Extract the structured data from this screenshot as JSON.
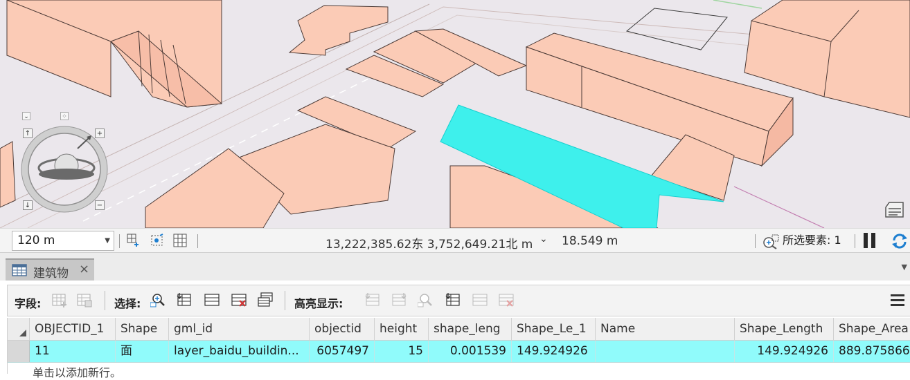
{
  "status_bar": {
    "scale": "120 m",
    "coordinates": "13,222,385.62东 3,752,649.21北 m",
    "elevation": "18.549 m",
    "selected_features": "所选要素: 1"
  },
  "tab": {
    "label": "建筑物",
    "close": "×"
  },
  "toolbar": {
    "fields_label": "字段:",
    "selection_label": "选择:",
    "highlight_label": "高亮显示:"
  },
  "table": {
    "columns": [
      "OBJECTID_1",
      "Shape",
      "gml_id",
      "objectid",
      "height",
      "shape_leng",
      "Shape_Le_1",
      "Name",
      "Shape_Length",
      "Shape_Area"
    ],
    "rows": [
      [
        "11",
        "面",
        "layer_baidu_buildin...",
        "6057497",
        "15",
        "0.001539",
        "149.924926",
        "",
        "149.924926",
        "889.875866"
      ]
    ],
    "add_row_hint": "单击以添加新行。"
  },
  "colors": {
    "building_fill": "#fbcbb6",
    "selected_fill": "#3ef0ec",
    "map_ground": "#ebe7ec",
    "row_highlight": "#90fbfb"
  },
  "icons": [
    "map-navigator-icon",
    "catalog-icon",
    "select-by-attributes-icon",
    "zoom-to-icon",
    "switch-selection-icon",
    "clear-selection-icon",
    "delete-selection-icon",
    "copy-selection-icon",
    "pause-drawing-icon",
    "refresh-icon",
    "table-menu-icon"
  ]
}
